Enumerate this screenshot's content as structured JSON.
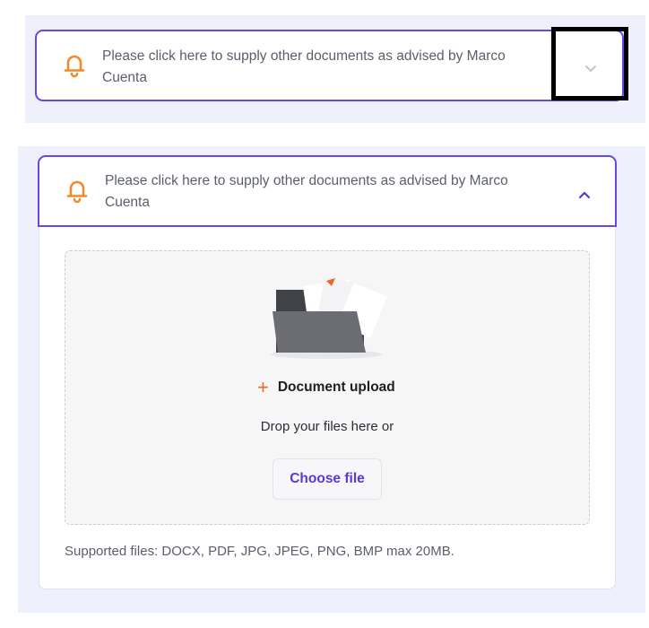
{
  "accordion_collapsed": {
    "message": "Please click here to supply other documents as advised by Marco Cuenta",
    "state": "collapsed",
    "icon": "bell-icon",
    "toggle_icon": "chevron-down-icon"
  },
  "accordion_expanded": {
    "message": "Please click here to supply other documents as advised by Marco Cuenta",
    "state": "expanded",
    "icon": "bell-icon",
    "toggle_icon": "chevron-up-icon"
  },
  "upload": {
    "illustration": "folder-illustration",
    "plus_symbol": "+",
    "title": "Document upload",
    "drop_text": "Drop your files here or",
    "choose_button": "Choose file",
    "supported_text": "Supported files: DOCX, PDF, JPG, JPEG, PNG, BMP max 20MB."
  },
  "colors": {
    "accent": "#6b46e6",
    "bell": "#f08a2c",
    "plus": "#e86a2c",
    "button_text": "#5b38d6",
    "panel_bg": "#eef1fb"
  }
}
